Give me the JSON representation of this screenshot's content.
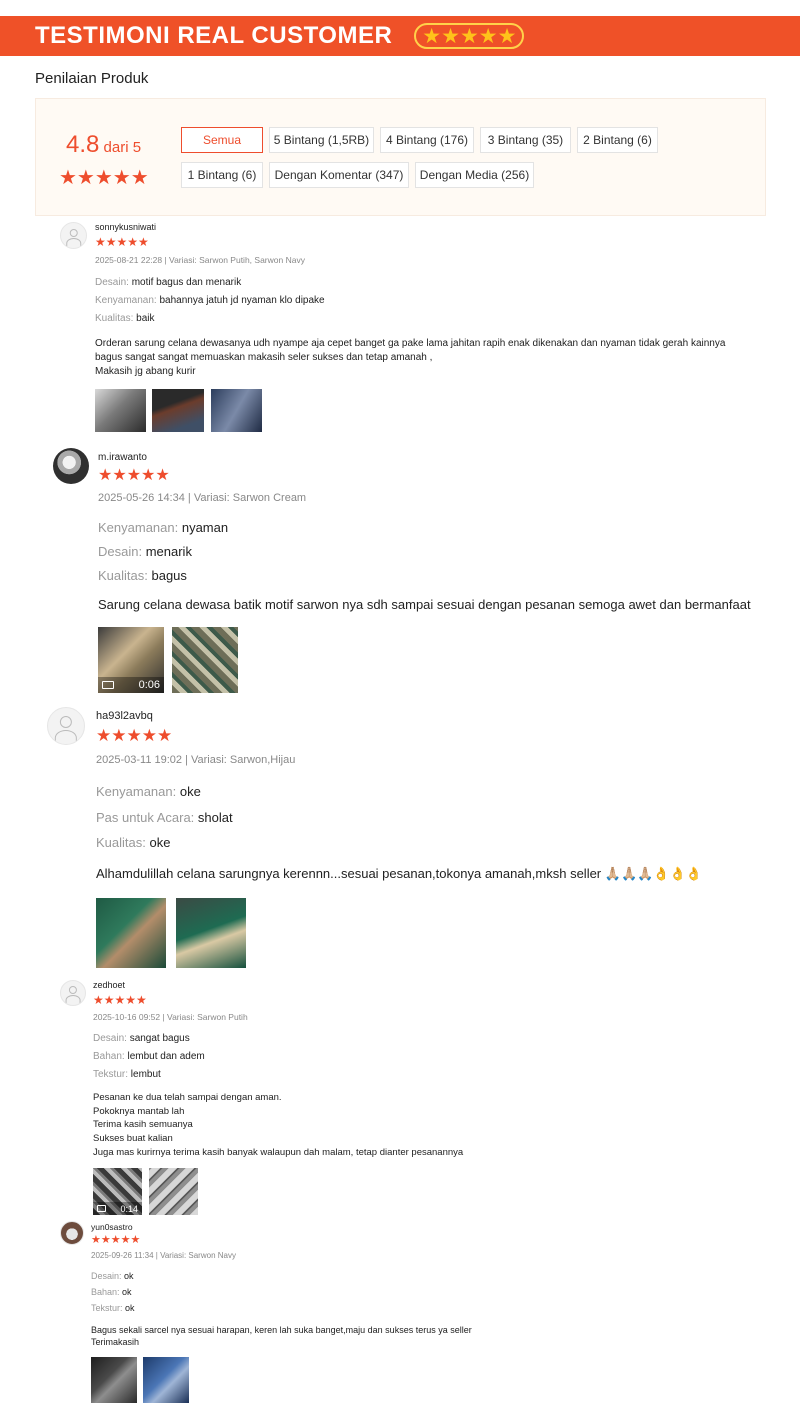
{
  "banner": {
    "title": "TESTIMONI REAL CUSTOMER",
    "stars": "★★★★★"
  },
  "section_title": "Penilaian Produk",
  "summary": {
    "rating": "4.8",
    "rating_suffix": " dari 5",
    "stars": "★★★★★",
    "filters": [
      "Semua",
      "5 Bintang (1,5RB)",
      "4 Bintang (176)",
      "3 Bintang (35)",
      "2 Bintang (6)",
      "1 Bintang (6)",
      "Dengan Komentar (347)",
      "Dengan Media (256)"
    ],
    "active_filter": "Semua"
  },
  "reviews": [
    {
      "user": "sonnykusniwati",
      "stars": "★★★★★",
      "meta": "2025-08-21 22:28 | Variasi: Sarwon Putih, Sarwon Navy",
      "attrs": [
        {
          "k": "Desain: ",
          "v": "motif bagus dan menarik"
        },
        {
          "k": "Kenyamanan: ",
          "v": "bahannya jatuh jd nyaman klo dipake"
        },
        {
          "k": "Kualitas: ",
          "v": "baik"
        }
      ],
      "comment": "Orderan sarung celana dewasanya udh nyampe aja cepet banget ga pake lama jahitan rapih enak dikenakan dan nyaman tidak gerah kainnya bagus sangat sangat memuaskan makasih seler sukses dan tetap amanah ,\nMakasih jg abang kurir"
    },
    {
      "user": "m.irawanto",
      "stars": "★★★★★",
      "meta": "2025-05-26 14:34 | Variasi: Sarwon Cream",
      "attrs": [
        {
          "k": "Kenyamanan: ",
          "v": "nyaman"
        },
        {
          "k": "Desain: ",
          "v": "menarik"
        },
        {
          "k": "Kualitas: ",
          "v": "bagus"
        }
      ],
      "comment": "Sarung celana dewasa batik motif sarwon nya sdh sampai sesuai dengan pesanan semoga awet dan bermanfaat",
      "video_duration": "0:06"
    },
    {
      "user": "ha93l2avbq",
      "stars": "★★★★★",
      "meta": "2025-03-11 19:02 | Variasi: Sarwon,Hijau",
      "attrs": [
        {
          "k": "Kenyamanan: ",
          "v": "oke"
        },
        {
          "k": "Pas untuk Acara: ",
          "v": "sholat"
        },
        {
          "k": "Kualitas: ",
          "v": "oke"
        }
      ],
      "comment": "Alhamdulillah celana sarungnya kerennn...sesuai pesanan,tokonya amanah,mksh seller 🙏🏼🙏🏼🙏🏼👌👌👌"
    },
    {
      "user": "zedhoet",
      "stars": "★★★★★",
      "meta": "2025-10-16 09:52 | Variasi: Sarwon Putih",
      "attrs": [
        {
          "k": "Desain: ",
          "v": "sangat bagus"
        },
        {
          "k": "Bahan: ",
          "v": "lembut dan adem"
        },
        {
          "k": "Tekstur: ",
          "v": "lembut"
        }
      ],
      "comment": "Pesanan ke dua telah sampai dengan aman.\nPokoknya mantab lah\nTerima kasih semuanya\nSukses buat kalian\nJuga mas kurirnya terima kasih banyak walaupun dah malam, tetap dianter pesanannya",
      "video_duration": "0:14"
    },
    {
      "user": "yun0sastro",
      "stars": "★★★★★",
      "meta": "2025-09-26 11:34 | Variasi: Sarwon Navy",
      "attrs": [
        {
          "k": "Desain: ",
          "v": "ok"
        },
        {
          "k": "Bahan: ",
          "v": "ok"
        },
        {
          "k": "Tekstur: ",
          "v": "ok"
        }
      ],
      "comment": "Bagus sekali sarcel nya sesuai harapan, keren lah suka banget,maju dan sukses terus ya seller\nTerimakasih"
    }
  ],
  "colors": {
    "banner": "#ef5128",
    "accent": "#ee4d2d",
    "banner_stars": "#ffc21a"
  }
}
